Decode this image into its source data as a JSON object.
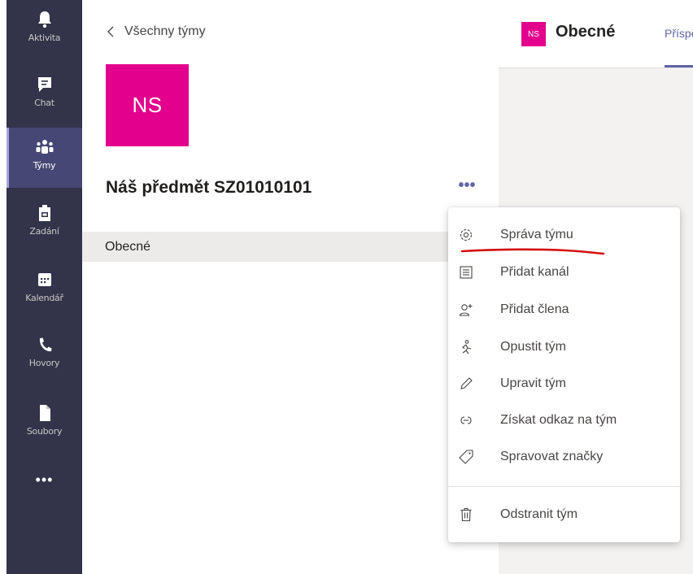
{
  "appbar": {
    "items": [
      {
        "label": "Aktivita",
        "icon": "bell-icon"
      },
      {
        "label": "Chat",
        "icon": "chat-icon"
      },
      {
        "label": "Týmy",
        "icon": "teams-icon"
      },
      {
        "label": "Zadání",
        "icon": "assignments-icon"
      },
      {
        "label": "Kalendář",
        "icon": "calendar-icon"
      },
      {
        "label": "Hovory",
        "icon": "phone-icon"
      },
      {
        "label": "Soubory",
        "icon": "file-icon"
      }
    ],
    "more": "•••",
    "active": "Týmy"
  },
  "panel": {
    "back_label": "Všechny týmy",
    "team_initials": "NS",
    "team_name": "Náš předmět SZ01010101",
    "more_label": "•••",
    "channel": "Obecné"
  },
  "channel_header": {
    "avatar_initials": "NS",
    "title": "Obecné",
    "tab": "Příspěvky"
  },
  "menu": {
    "items": [
      {
        "label": "Správa týmu",
        "icon": "gear-icon"
      },
      {
        "label": "Přidat kanál",
        "icon": "list-icon"
      },
      {
        "label": "Přidat člena",
        "icon": "add-person-icon"
      },
      {
        "label": "Opustit tým",
        "icon": "leave-icon"
      },
      {
        "label": "Upravit tým",
        "icon": "pencil-icon"
      },
      {
        "label": "Získat odkaz na tým",
        "icon": "link-icon"
      },
      {
        "label": "Spravovat značky",
        "icon": "tag-icon"
      },
      {
        "label": "Odstranit tým",
        "icon": "trash-icon"
      }
    ]
  },
  "colors": {
    "appbar_bg": "#33344a",
    "accent": "#6264a7",
    "team_avatar": "#e3008c",
    "annotation": "#d40e0e"
  }
}
